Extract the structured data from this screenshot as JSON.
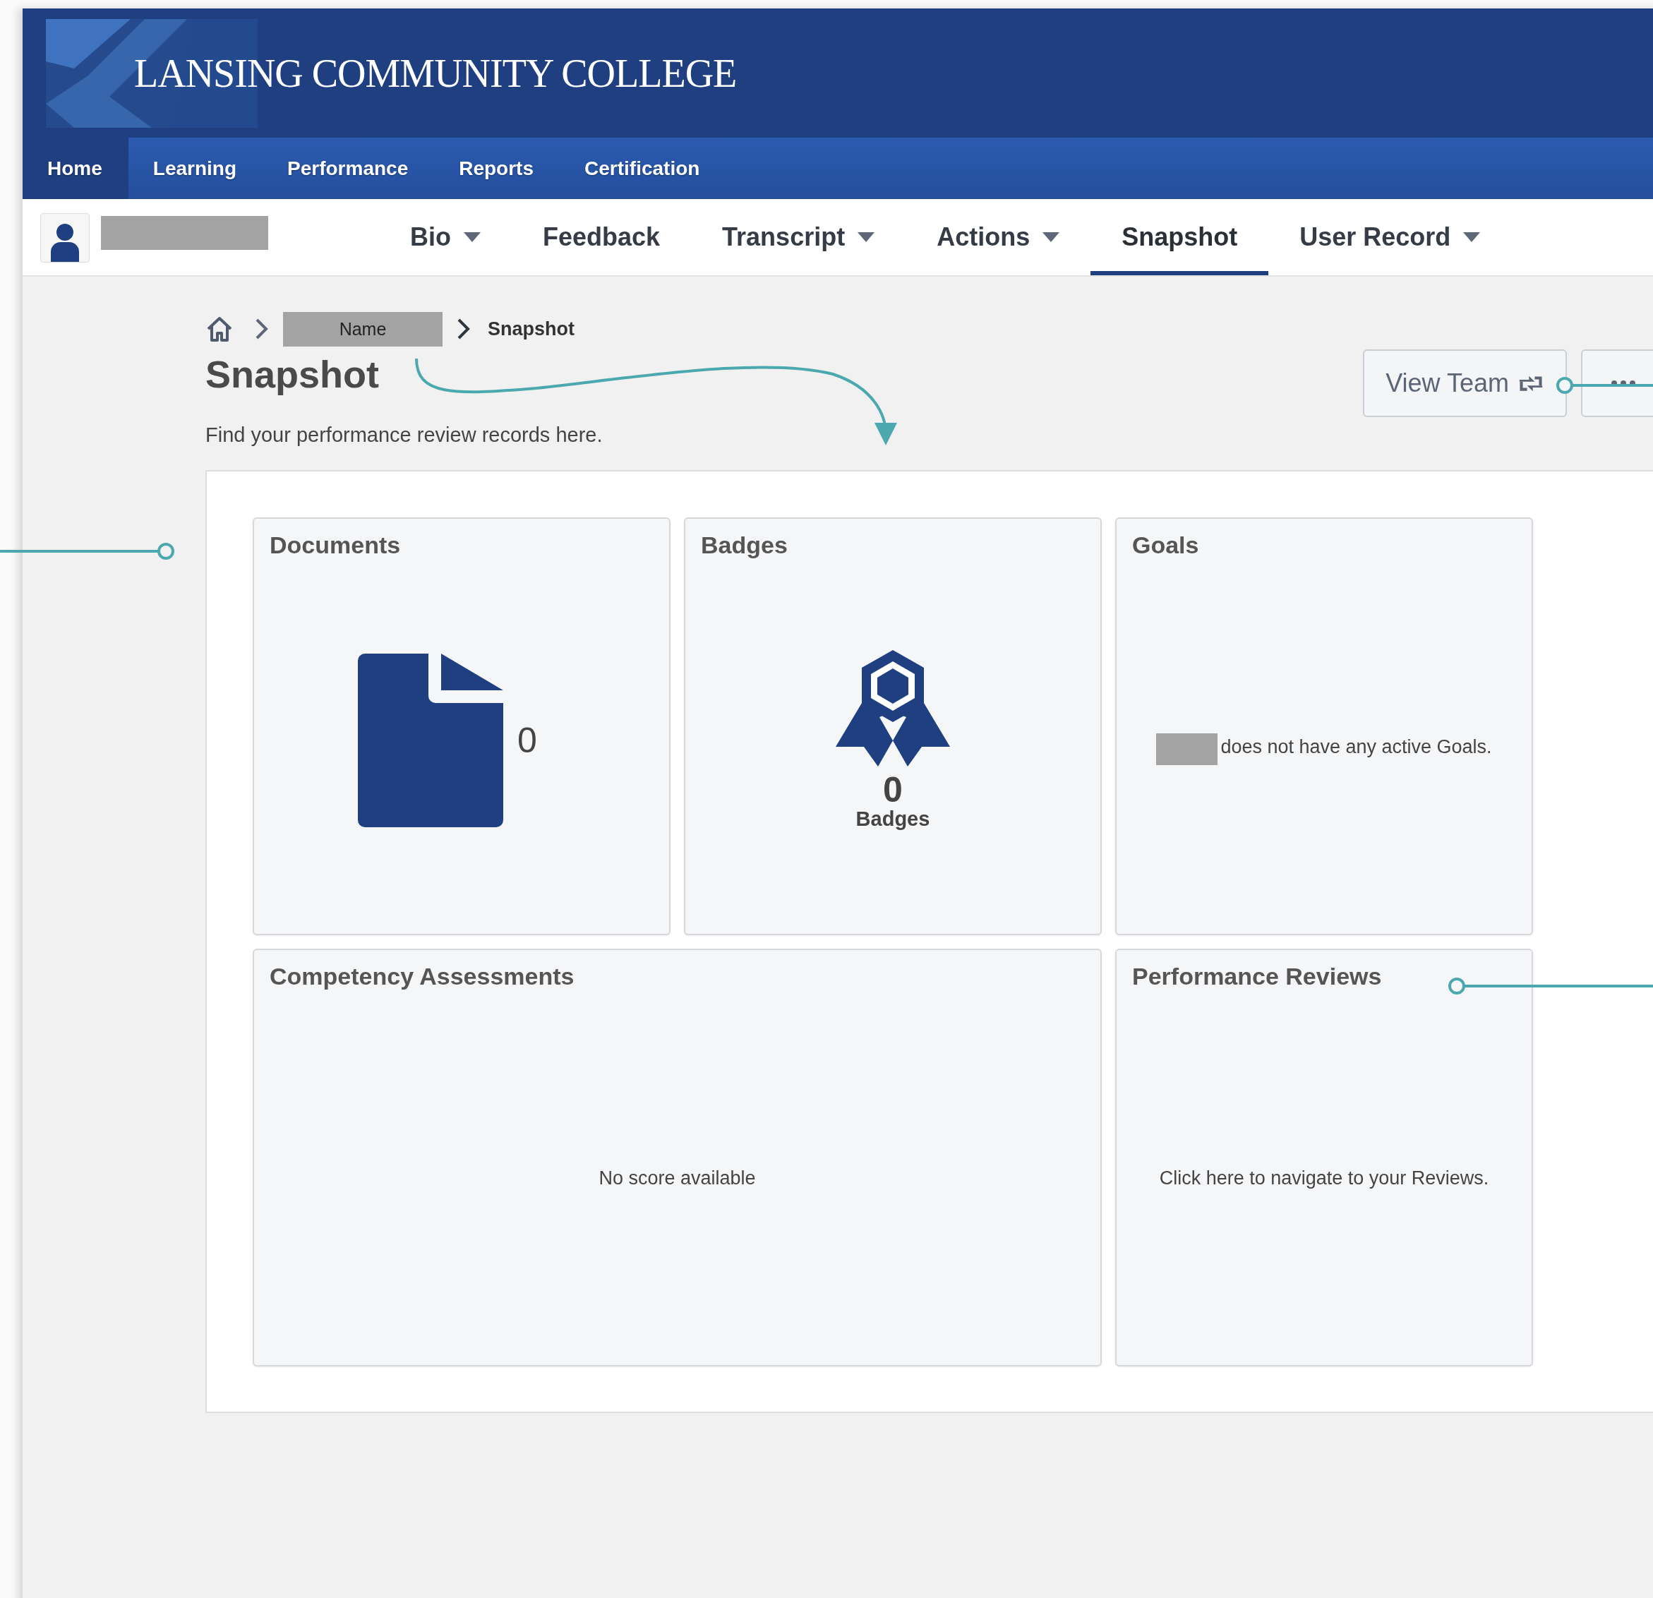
{
  "header": {
    "logo": "LANSING COMMUNITY COLLEGE"
  },
  "nav": [
    {
      "label": "Home",
      "selected": true
    },
    {
      "label": "Learning",
      "selected": false
    },
    {
      "label": "Performance",
      "selected": false
    },
    {
      "label": "Reports",
      "selected": false
    },
    {
      "label": "Certification",
      "selected": false
    }
  ],
  "subnav": [
    {
      "label": "Bio",
      "dropdown": true,
      "selected": false
    },
    {
      "label": "Feedback",
      "dropdown": false,
      "selected": false
    },
    {
      "label": "Transcript",
      "dropdown": true,
      "selected": false
    },
    {
      "label": "Actions",
      "dropdown": true,
      "selected": false
    },
    {
      "label": "Snapshot",
      "dropdown": false,
      "selected": true
    },
    {
      "label": "User Record",
      "dropdown": true,
      "selected": false
    }
  ],
  "breadcrumb": [
    {
      "label": "Name",
      "kind": "redacted"
    },
    {
      "label": "Snapshot",
      "kind": "current"
    }
  ],
  "page": {
    "title": "Snapshot",
    "description": "Find your performance review records here."
  },
  "view_team_button": "View Team",
  "cards": [
    {
      "kind": "documents",
      "title": "Documents",
      "count": "0"
    },
    {
      "kind": "badges",
      "title": "Badges",
      "count": "0",
      "label": "Badges"
    },
    {
      "kind": "goals",
      "title": "Goals",
      "message": "does not have any active Goals."
    },
    {
      "kind": "competency",
      "title": "Competency Assessments",
      "message": "No score available"
    },
    {
      "kind": "reviews",
      "title": "Performance Reviews",
      "message": "Click here to navigate to your Reviews."
    }
  ]
}
